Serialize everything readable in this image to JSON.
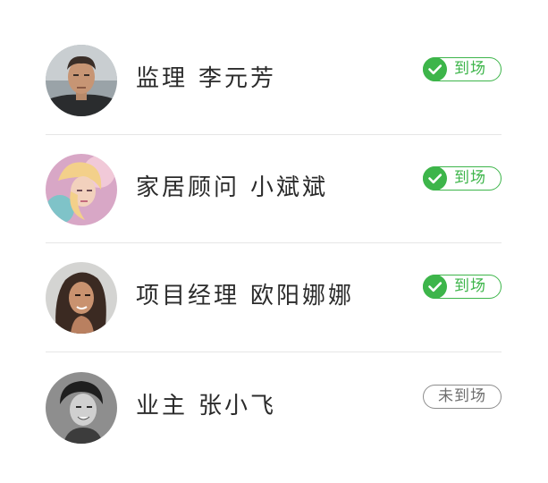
{
  "attendees": [
    {
      "role": "监理",
      "name": "李元芳",
      "status": "到场",
      "present": true,
      "avatar_icon": "man-portrait-avatar"
    },
    {
      "role": "家居顾问",
      "name": "小斌斌",
      "status": "到场",
      "present": true,
      "avatar_icon": "woman-portrait-avatar"
    },
    {
      "role": "项目经理",
      "name": "欧阳娜娜",
      "status": "到场",
      "present": true,
      "avatar_icon": "woman-portrait-avatar"
    },
    {
      "role": "业主",
      "name": "张小飞",
      "status": "未到场",
      "present": false,
      "avatar_icon": "man-portrait-avatar"
    }
  ],
  "colors": {
    "present_green": "#3db54a",
    "absent_gray": "#8c8c8c",
    "divider": "#e6e6e6",
    "text": "#2b2b2b"
  }
}
